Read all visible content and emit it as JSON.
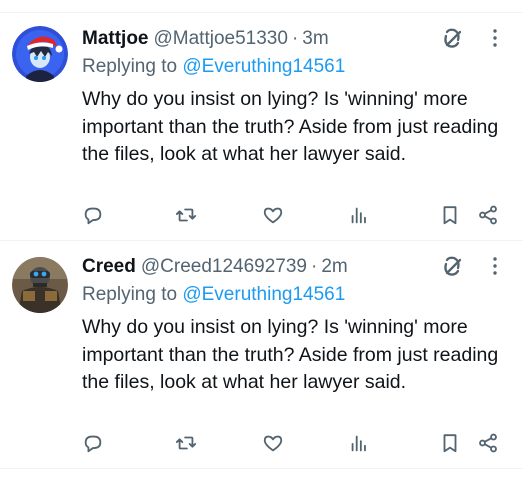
{
  "tweets": [
    {
      "display_name": "Mattjoe",
      "handle": "@Mattjoe51330",
      "separator": "·",
      "time": "3m",
      "replying_prefix": "Replying to",
      "replying_handle": "@Everuthing14561",
      "body": "Why do you insist on lying? Is 'winning' more important than the truth? Aside from just reading the files, look at what her lawyer said."
    },
    {
      "display_name": "Creed",
      "handle": "@Creed124692739",
      "separator": "·",
      "time": "2m",
      "replying_prefix": "Replying to",
      "replying_handle": "@Everuthing14561",
      "body": "Why do you insist on lying? Is 'winning' more important than the truth? Aside from just reading the files, look at what her lawyer said."
    }
  ],
  "colors": {
    "text": "#0f1419",
    "secondary": "#536471",
    "link": "#1d9bf0",
    "divider": "#eff3f4"
  },
  "icons": [
    "grok-icon",
    "more-icon",
    "reply-icon",
    "repost-icon",
    "like-icon",
    "views-icon",
    "bookmark-icon",
    "share-icon"
  ]
}
